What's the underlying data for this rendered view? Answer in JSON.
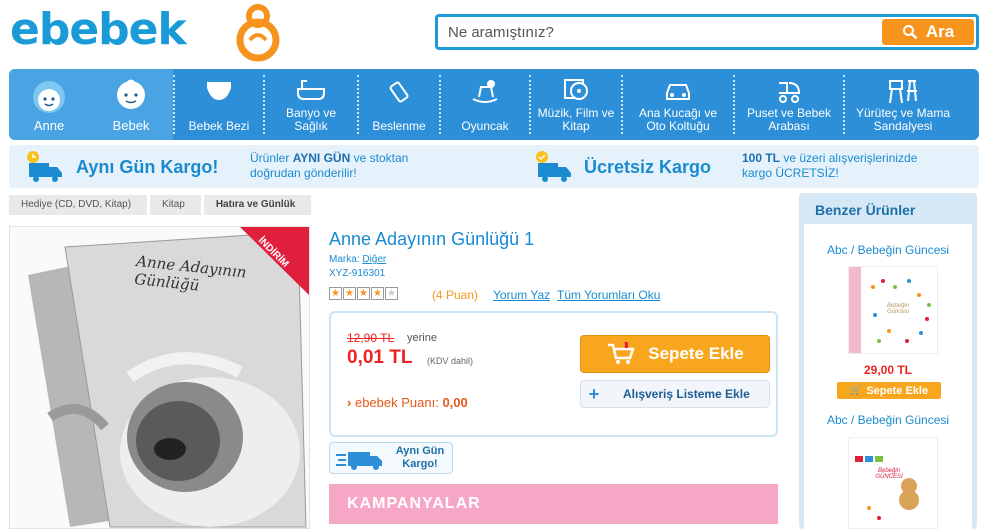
{
  "brand": {
    "name": "ebebek",
    "color": "#1a9bd7",
    "accent": "#f7941d"
  },
  "search": {
    "placeholder": "Ne aramıştınız?",
    "button_label": "Ara"
  },
  "nav": {
    "items": [
      {
        "label": "Anne",
        "icon": "mother-face-icon"
      },
      {
        "label": "Bebek",
        "icon": "baby-face-icon"
      },
      {
        "label": "Bebek Bezi",
        "icon": "diaper-icon"
      },
      {
        "label": "Banyo ve Sağlık",
        "icon": "bathtub-icon"
      },
      {
        "label": "Beslenme",
        "icon": "baby-bottle-icon"
      },
      {
        "label": "Oyuncak",
        "icon": "rocking-horse-icon"
      },
      {
        "label": "Müzik, Film ve Kitap",
        "icon": "cd-icon"
      },
      {
        "label": "Ana Kucağı ve Oto Koltuğu",
        "icon": "car-icon"
      },
      {
        "label": "Puset ve Bebek Arabası",
        "icon": "stroller-icon"
      },
      {
        "label": "Yürüteç ve Mama Sandalyesi",
        "icon": "high-chair-icon"
      }
    ]
  },
  "shipping": {
    "same_day_title": "Aynı Gün Kargo!",
    "same_day_desc_1": "Ürünler ",
    "same_day_desc_bold": "AYNI GÜN",
    "same_day_desc_2": " ve stoktan",
    "same_day_desc_3": "doğrudan gönderilir!",
    "free_title": "Ücretsiz Kargo",
    "free_desc_bold": "100 TL",
    "free_desc_1": " ve üzeri alışverişlerinizde",
    "free_desc_2": "kargo ÜCRETSİZ!"
  },
  "breadcrumb": [
    "Hediye (CD, DVD, Kitap)",
    "Kitap",
    "Hatıra ve Günlük"
  ],
  "product": {
    "title": "Anne Adayının Günlüğü 1",
    "brand_label": "Marka: ",
    "brand": "Diğer",
    "sku": "XYZ-916301",
    "ribbon": "İNDİRİM",
    "cover_text": "Anne Adayının Günlüğü",
    "rating": 4,
    "rating_max": 5,
    "rating_text": "(4 Puan)",
    "write_review": "Yorum Yaz",
    "read_reviews": "Tüm Yorumları Oku",
    "old_price": "12,90 TL",
    "instead_label": "yerine",
    "price": "0,01 TL",
    "vat_label": "(KDV dahil)",
    "points_label": "ebebek Puanı:",
    "points": "0,00",
    "add_to_cart": "Sepete Ekle",
    "add_to_list": "Alışveriş Listeme Ekle",
    "same_day_badge_1": "Aynı Gün",
    "same_day_badge_2": "Kargo!",
    "campaigns_title": "KAMPANYALAR"
  },
  "similar": {
    "title": "Benzer Ürünler",
    "items": [
      {
        "name": "Abc / Bebeğin Güncesi",
        "price": "29,00 TL",
        "cart_label": "Sepete Ekle",
        "thumb_title": "Bebeğin Güncesi"
      },
      {
        "name": "Abc / Bebeğin Güncesi",
        "thumb_title": "Bebeğin GÜNCESİ"
      }
    ]
  }
}
